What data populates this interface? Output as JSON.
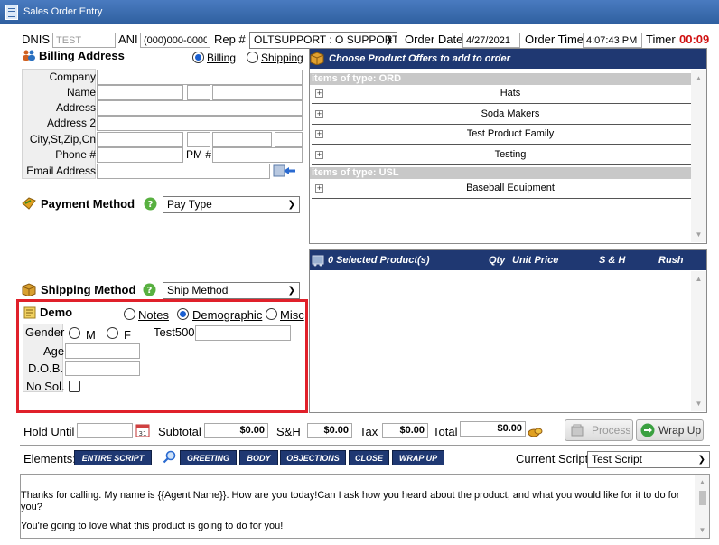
{
  "window": {
    "title": "Sales Order Entry"
  },
  "top": {
    "dnis_label": "DNIS",
    "dnis_value": "TEST",
    "ani_label": "ANI",
    "ani_value": "(000)000-0000",
    "rep_label": "Rep #",
    "rep_value": "OLTSUPPORT : O SUPPORT",
    "order_date_label": "Order Date",
    "order_date_value": "4/27/2021",
    "order_time_label": "Order Time",
    "order_time_value": "4:07:43 PM",
    "timer_label": "Timer",
    "timer_value": "00:09"
  },
  "billing": {
    "title": "Billing Address",
    "radio_billing": "Billing",
    "radio_shipping": "Shipping",
    "labels": {
      "company": "Company",
      "name": "Name",
      "address": "Address",
      "address2": "Address 2",
      "city": "City,St,Zip,Cn",
      "phone": "Phone #",
      "pm": "PM #",
      "email": "Email Address"
    }
  },
  "payment": {
    "title": "Payment Method",
    "select_value": "Pay Type"
  },
  "shipping": {
    "title": "Shipping Method",
    "select_value": "Ship Method"
  },
  "demo": {
    "title": "Demo",
    "radio_notes": "Notes",
    "radio_demographic": "Demographic",
    "radio_misc": "Misc",
    "gender_label": "Gender",
    "gender_m": "M",
    "gender_f": "F",
    "test500_label": "Test500",
    "age_label": "Age",
    "dob_label": "D.O.B.",
    "nosol_label": "No Sol."
  },
  "offers": {
    "header": "Choose Product Offers to add to order",
    "group1": "items of type: ORD",
    "group1_items": [
      "Hats",
      "Soda Makers",
      "Test Product Family",
      "Testing"
    ],
    "group2": "items of type: USL",
    "group2_items": [
      "Baseball Equipment"
    ]
  },
  "selected": {
    "header": "0 Selected Product(s)",
    "col_qty": "Qty",
    "col_unit_price": "Unit Price",
    "col_sh": "S & H",
    "col_rush": "Rush"
  },
  "totals": {
    "hold_until_label": "Hold Until",
    "subtotal_label": "Subtotal",
    "subtotal_value": "$0.00",
    "sh_label": "S&H",
    "sh_value": "$0.00",
    "tax_label": "Tax",
    "tax_value": "$0.00",
    "total_label": "Total",
    "total_value": "$0.00",
    "process_label": "Process",
    "wrapup_label": "Wrap Up"
  },
  "script": {
    "elements_label": "Elements:",
    "tabs": [
      "ENTIRE SCRIPT",
      "GREETING",
      "BODY",
      "OBJECTIONS",
      "CLOSE",
      "WRAP UP"
    ],
    "current_label": "Current Script",
    "current_value": "Test Script",
    "text_line1": "Thanks for calling. My name is {{Agent Name}}.  How are you today!Can I ask how you heard about the product, and what you would like for it to do for",
    "text_line2": "you?",
    "text_line3": "You're going to love what this product is going to do for you!"
  },
  "colors": {
    "accent": "#1f3872",
    "highlight": "#e0202a",
    "timer": "#d01010"
  }
}
